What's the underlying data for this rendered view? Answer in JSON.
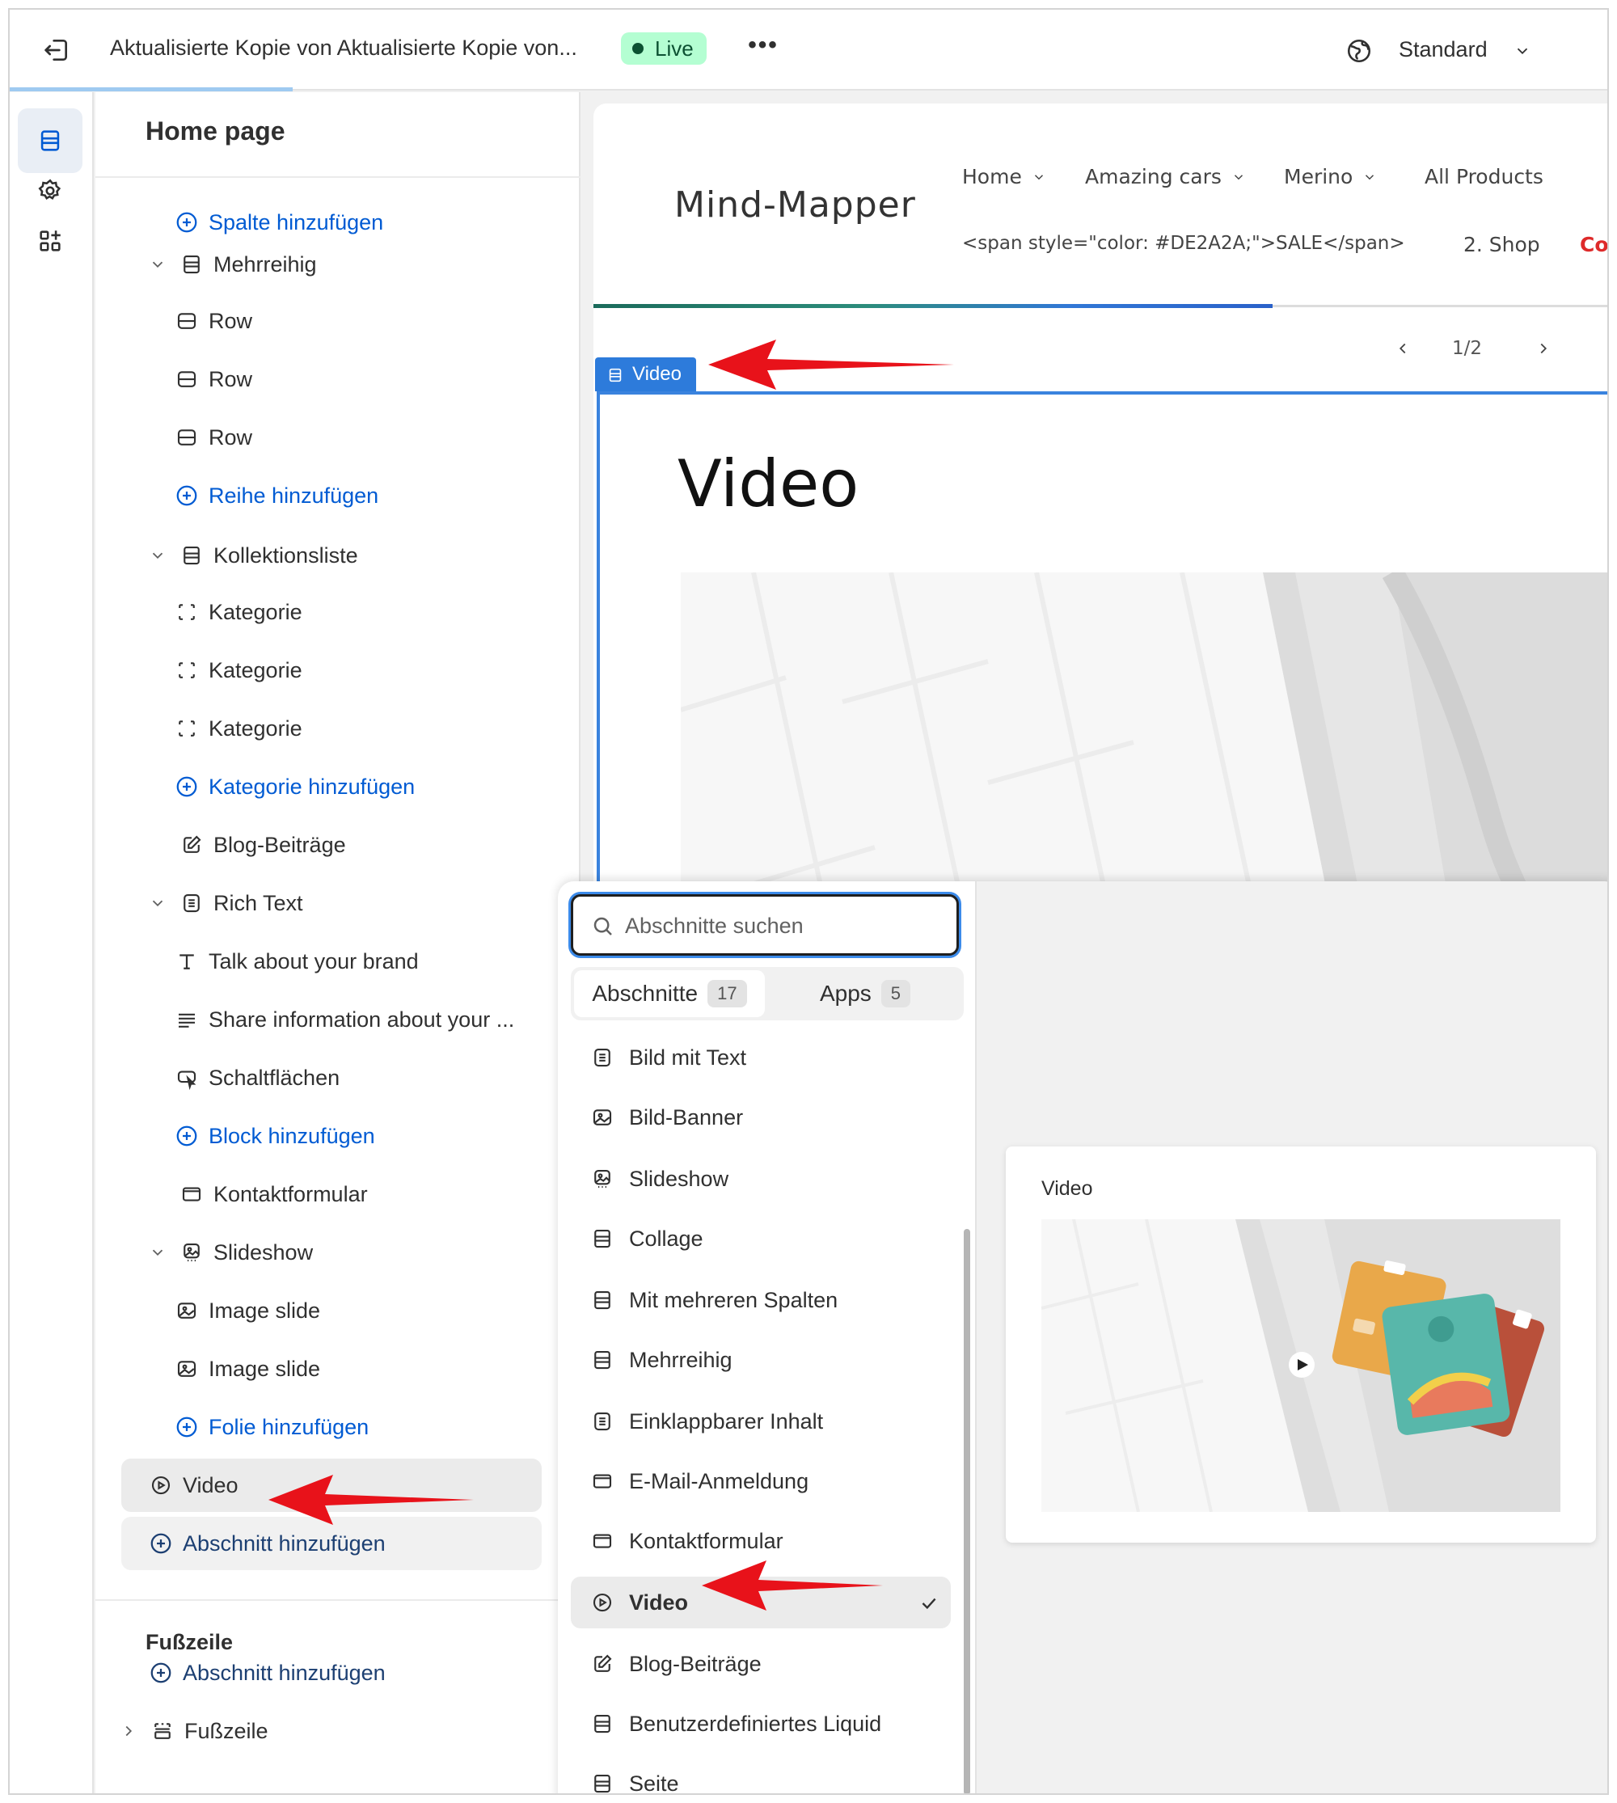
{
  "topbar": {
    "title": "Aktualisierte Kopie von Aktualisierte Kopie von...",
    "status": "Live",
    "more_label": "•••",
    "viewport_label": "Standard"
  },
  "sidebar": {
    "heading": "Home page",
    "items": [
      {
        "label": "Spalte hinzufügen",
        "kind": "add"
      },
      {
        "label": "Mehrreihig",
        "kind": "section"
      },
      {
        "label": "Row",
        "kind": "block"
      },
      {
        "label": "Row",
        "kind": "block"
      },
      {
        "label": "Row",
        "kind": "block"
      },
      {
        "label": "Reihe hinzufügen",
        "kind": "add"
      },
      {
        "label": "Kollektionsliste",
        "kind": "section"
      },
      {
        "label": "Kategorie",
        "kind": "block"
      },
      {
        "label": "Kategorie",
        "kind": "block"
      },
      {
        "label": "Kategorie",
        "kind": "block"
      },
      {
        "label": "Kategorie hinzufügen",
        "kind": "add"
      },
      {
        "label": "Blog-Beiträge",
        "kind": "section"
      },
      {
        "label": "Rich Text",
        "kind": "section"
      },
      {
        "label": "Talk about your brand",
        "kind": "block"
      },
      {
        "label": "Share information about your ...",
        "kind": "block"
      },
      {
        "label": "Schaltflächen",
        "kind": "block"
      },
      {
        "label": "Block hinzufügen",
        "kind": "add"
      },
      {
        "label": "Kontaktformular",
        "kind": "section"
      },
      {
        "label": "Slideshow",
        "kind": "section"
      },
      {
        "label": "Image slide",
        "kind": "block"
      },
      {
        "label": "Image slide",
        "kind": "block"
      },
      {
        "label": "Folie hinzufügen",
        "kind": "add"
      },
      {
        "label": "Video",
        "kind": "section",
        "selected": true
      },
      {
        "label": "Abschnitt hinzufügen",
        "kind": "add-section"
      }
    ],
    "footer_heading": "Fußzeile",
    "footer_items": [
      {
        "label": "Abschnitt hinzufügen"
      },
      {
        "label": "Fußzeile"
      }
    ]
  },
  "preview": {
    "store_name": "Mind-Mapper",
    "nav_row1": [
      "Home",
      "Amazing cars",
      "Merino",
      "All Products"
    ],
    "nav_row2": [
      "<span style=\"color: #DE2A2A;\">SALE</span>",
      "2. Shop",
      "Coll"
    ],
    "pager": "1/2",
    "section_tag": "Video",
    "section_heading": "Video"
  },
  "picker": {
    "search_placeholder": "Abschnitte suchen",
    "tabs": [
      {
        "label": "Abschnitte",
        "count": "17",
        "active": true
      },
      {
        "label": "Apps",
        "count": "5",
        "active": false
      }
    ],
    "items": [
      {
        "label": "Bild mit Text",
        "icon": "text-block-icon"
      },
      {
        "label": "Bild-Banner",
        "icon": "image-icon"
      },
      {
        "label": "Slideshow",
        "icon": "slideshow-icon"
      },
      {
        "label": "Collage",
        "icon": "layout-icon"
      },
      {
        "label": "Mit mehreren Spalten",
        "icon": "layout-icon"
      },
      {
        "label": "Mehrreihig",
        "icon": "layout-icon"
      },
      {
        "label": "Einklappbarer Inhalt",
        "icon": "text-block-icon"
      },
      {
        "label": "E-Mail-Anmeldung",
        "icon": "email-icon"
      },
      {
        "label": "Kontaktformular",
        "icon": "email-icon"
      },
      {
        "label": "Video",
        "icon": "play-icon",
        "selected": true
      },
      {
        "label": "Blog-Beiträge",
        "icon": "edit-icon"
      },
      {
        "label": "Benutzerdefiniertes Liquid",
        "icon": "layout-icon"
      },
      {
        "label": "Seite",
        "icon": "layout-icon"
      }
    ],
    "preview_title": "Video"
  },
  "colors": {
    "accent": "#005bd3",
    "live_bg": "#b4fed2",
    "live_text": "#0c5132",
    "section_outline": "#3a83de",
    "sale_red": "#de2a2a",
    "annotation_arrow": "#e8121a"
  }
}
